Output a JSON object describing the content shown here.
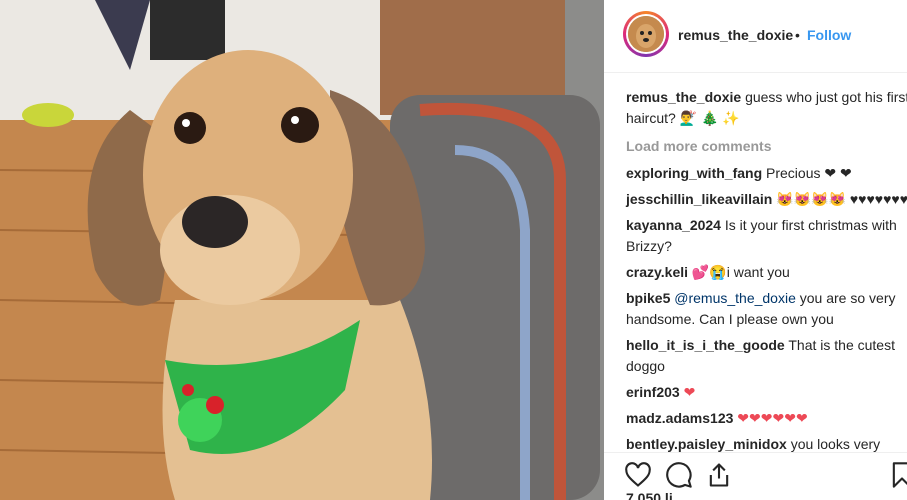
{
  "post": {
    "username": "remus_the_doxie",
    "separator": "•",
    "follow_label": "Follow",
    "caption_text": "guess who just got his first haircut? 💇‍♂️ 🎄 ✨",
    "load_more": "Load more comments"
  },
  "comments": [
    {
      "user": "exploring_with_fang",
      "text": "Precious ❤ ❤"
    },
    {
      "user": "jesschillin_likeavillain",
      "text": "😻😻😻😻 ♥♥♥♥♥♥♥♥"
    },
    {
      "user": "kayanna_2024",
      "text": "Is it your first christmas with Brizzy?"
    },
    {
      "user": "crazy.keli",
      "text": "💕😭i want you"
    },
    {
      "user": "bpike5",
      "mention": "@remus_the_doxie",
      "text": "you are so very handsome. Can I please own you"
    },
    {
      "user": "hello_it_is_i_the_goode",
      "text": "That is the cutest doggo"
    },
    {
      "user": "erinf203",
      "text": "❤"
    },
    {
      "user": "madz.adams123",
      "text": "❤❤❤❤❤❤"
    },
    {
      "user": "bentley.paisley_minidox",
      "text": "you looks very handsome 😍💕❤"
    }
  ],
  "likes": "7,050 li...",
  "icons": [
    "heart-icon",
    "comment-icon",
    "share-icon",
    "bookmark-icon"
  ],
  "colors": {
    "link": "#3897f0",
    "text": "#262626",
    "muted": "#999999",
    "heart": "#ed4956",
    "bandana": "#2fb34a"
  }
}
